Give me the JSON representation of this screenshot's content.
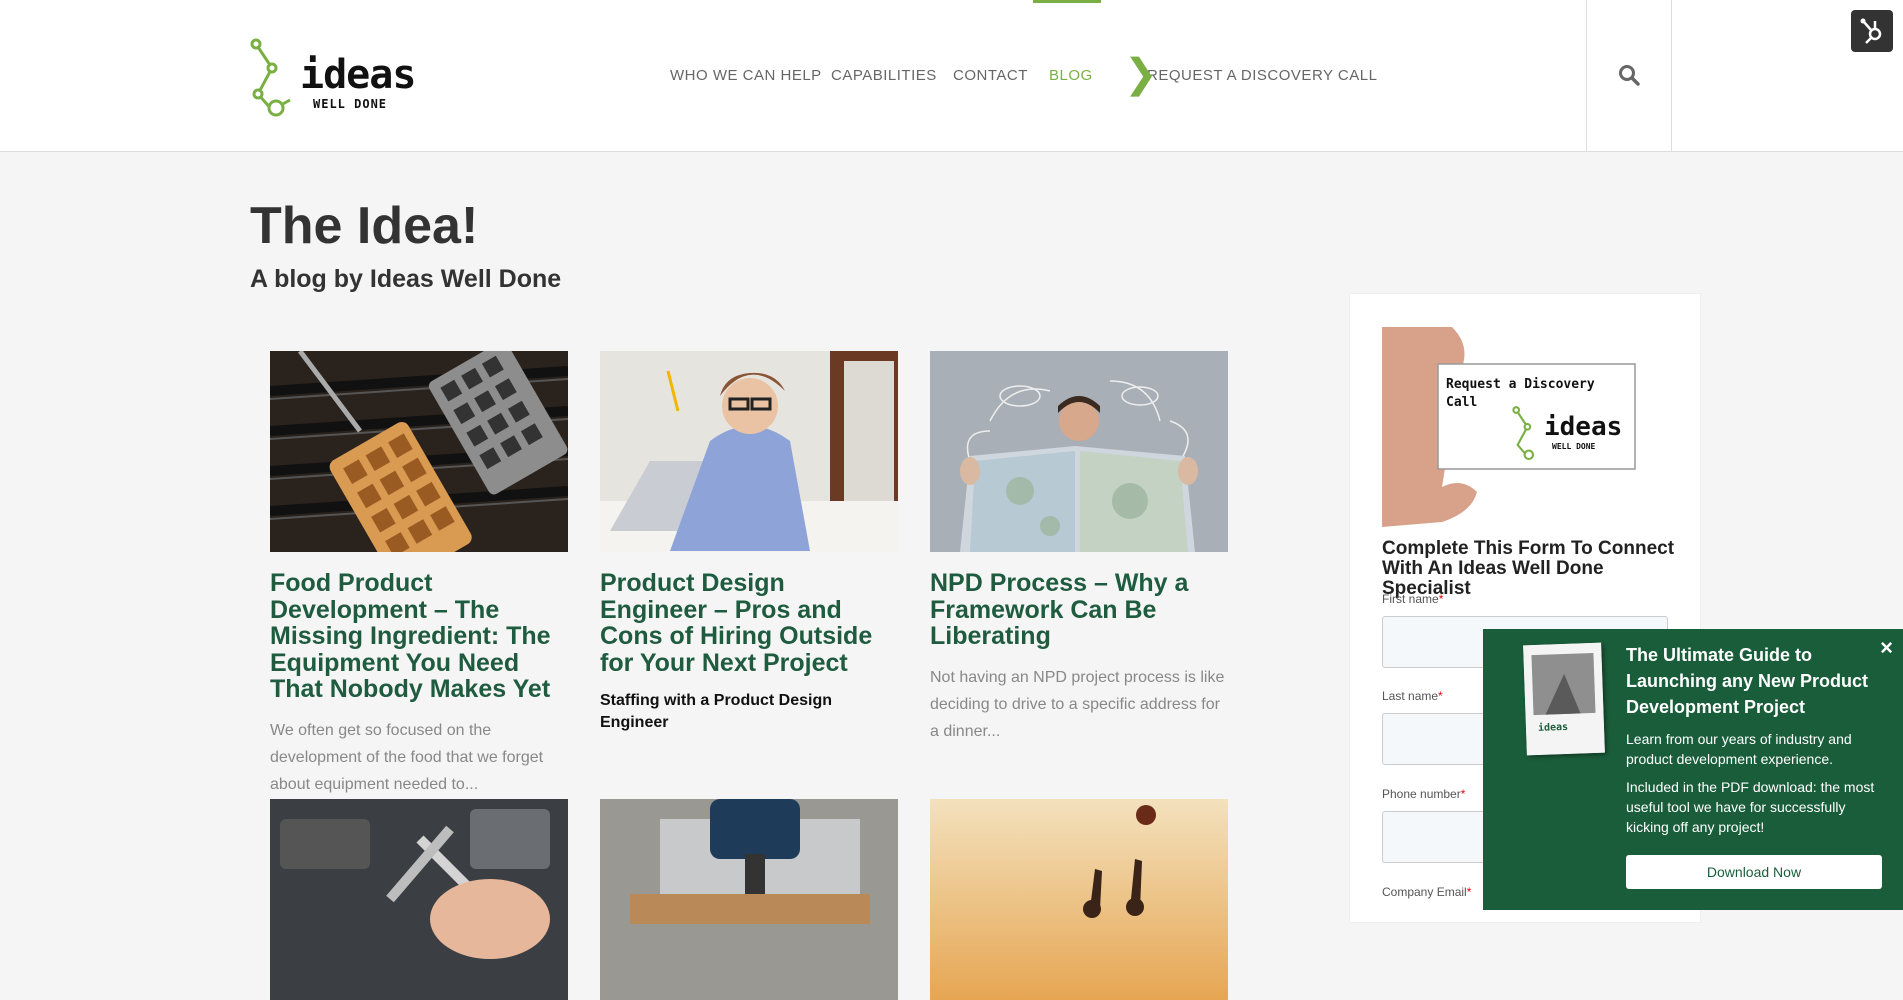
{
  "header": {
    "logo_word": "ideas",
    "logo_sub": "WELL DONE",
    "nav": [
      {
        "label": "WHO WE CAN HELP"
      },
      {
        "label": "CAPABILITIES"
      },
      {
        "label": "CONTACT"
      },
      {
        "label": "BLOG",
        "active": true
      },
      {
        "label": "REQUEST A DISCOVERY CALL"
      }
    ],
    "accent_color": "#7ab043"
  },
  "page": {
    "title": "The Idea!",
    "subtitle": "A blog by Ideas Well Done"
  },
  "posts": [
    {
      "title": "Food Product Development – The Missing Ingredient: The Equipment You Need That Nobody Makes Yet",
      "excerpt": "We often get so focused on the development of the food that we forget about equipment needed to..."
    },
    {
      "title": "Product Design Engineer – Pros and Cons of Hiring Outside for Your Next Project",
      "excerpt": "Staffing with a Product Design Engineer"
    },
    {
      "title": "NPD Process – Why a Framework Can Be Liberating",
      "excerpt": "Not having an NPD project process is like deciding to drive to a specific address for a dinner..."
    }
  ],
  "sidebar": {
    "card_text_1": "Request a Discovery",
    "card_text_2": "Call",
    "heading": "Complete This Form To Connect With An Ideas Well Done Specialist",
    "fields": [
      {
        "label": "First name"
      },
      {
        "label": "Last name"
      },
      {
        "label": "Phone number"
      },
      {
        "label": "Company Email"
      }
    ],
    "required_mark": "*"
  },
  "popup": {
    "title": "The Ultimate Guide to Launching any New Product Development Project",
    "text1": "Learn from our years of industry and product development experience.",
    "text2": "Included in the PDF download: the most useful tool we have for successfully kicking off any project!",
    "button": "Download Now",
    "close": "×"
  }
}
